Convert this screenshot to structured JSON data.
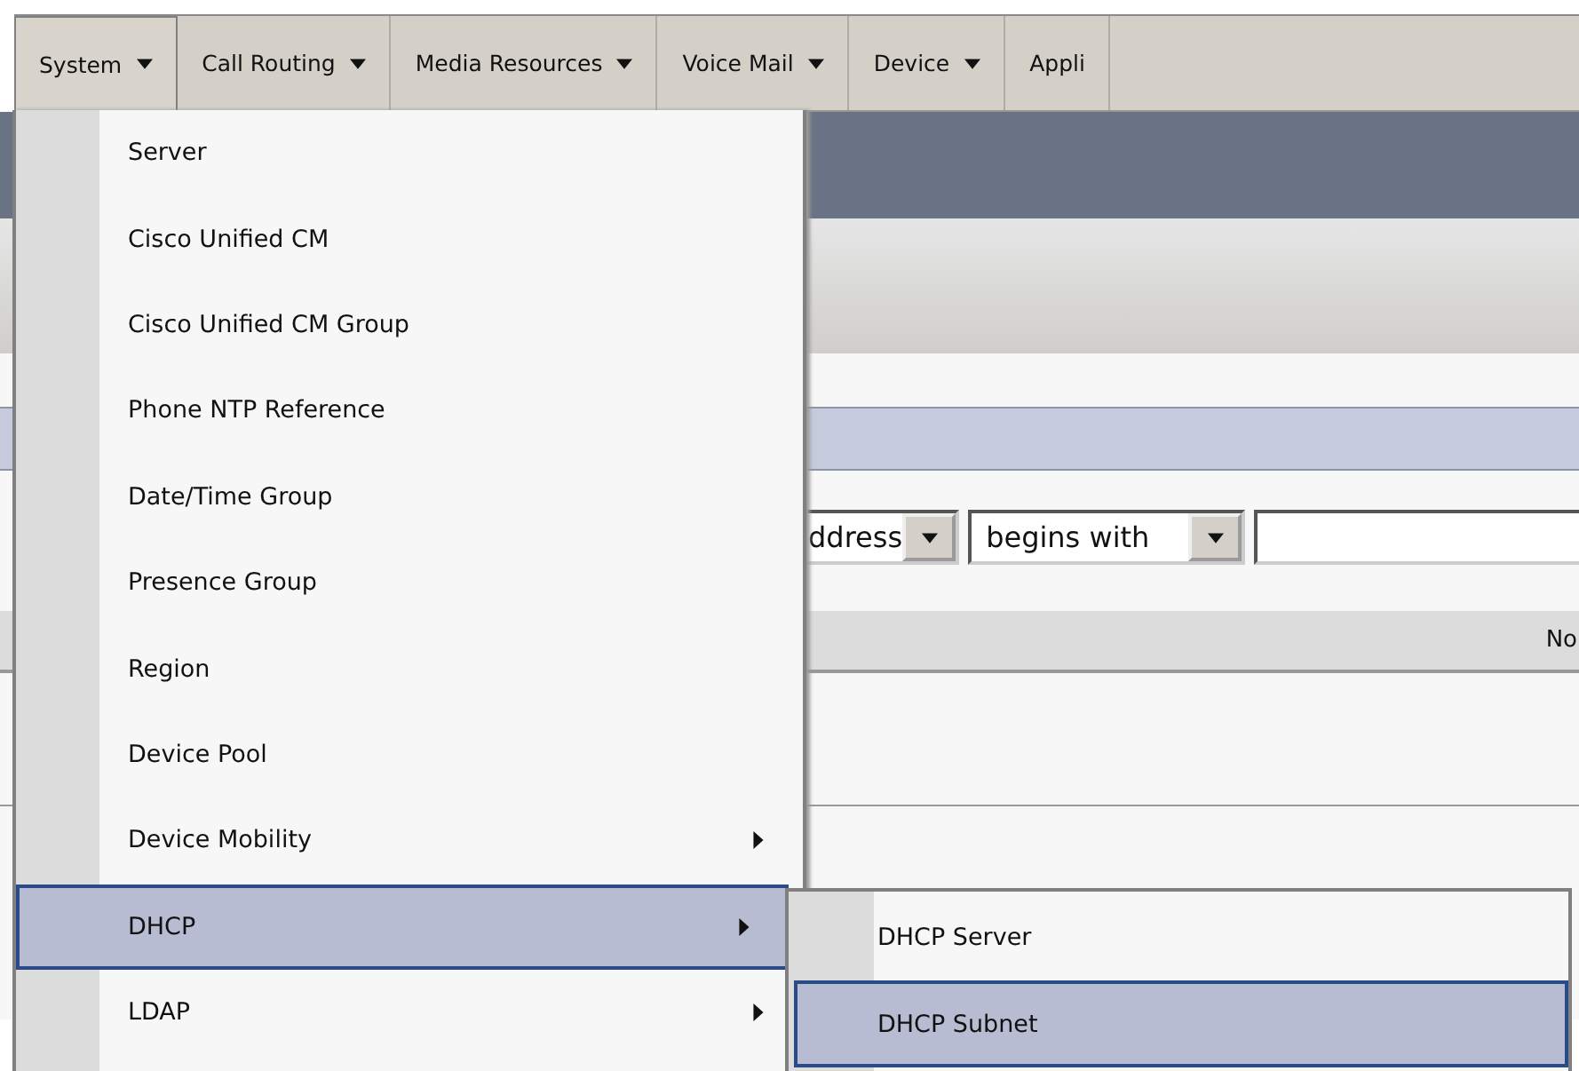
{
  "menubar": [
    {
      "label": "System",
      "has_menu": true,
      "selected": true
    },
    {
      "label": "Call Routing",
      "has_menu": true,
      "selected": false
    },
    {
      "label": "Media Resources",
      "has_menu": true,
      "selected": false
    },
    {
      "label": "Voice Mail",
      "has_menu": true,
      "selected": false
    },
    {
      "label": "Device",
      "has_menu": true,
      "selected": false
    },
    {
      "label": "Appli",
      "has_menu": false,
      "selected": false
    }
  ],
  "menu": {
    "items": [
      {
        "label": "Server",
        "has_submenu": false,
        "selected": false
      },
      {
        "label": "Cisco Unified CM",
        "has_submenu": false,
        "selected": false
      },
      {
        "label": "Cisco Unified CM Group",
        "has_submenu": false,
        "selected": false
      },
      {
        "label": "Phone NTP Reference",
        "has_submenu": false,
        "selected": false
      },
      {
        "label": "Date/Time Group",
        "has_submenu": false,
        "selected": false
      },
      {
        "label": "Presence Group",
        "has_submenu": false,
        "selected": false
      },
      {
        "label": "Region",
        "has_submenu": false,
        "selected": false
      },
      {
        "label": "Device Pool",
        "has_submenu": false,
        "selected": false
      },
      {
        "label": "Device Mobility",
        "has_submenu": true,
        "selected": false
      },
      {
        "label": "DHCP",
        "has_submenu": true,
        "selected": true
      },
      {
        "label": "LDAP",
        "has_submenu": true,
        "selected": false
      }
    ]
  },
  "submenu": {
    "items": [
      {
        "label": "DHCP Server",
        "selected": false
      },
      {
        "label": "DHCP Subnet",
        "selected": true
      }
    ]
  },
  "search": {
    "field_select": "ddress",
    "match_select": "begins with"
  },
  "table": {
    "columns": [
      "No"
    ]
  }
}
